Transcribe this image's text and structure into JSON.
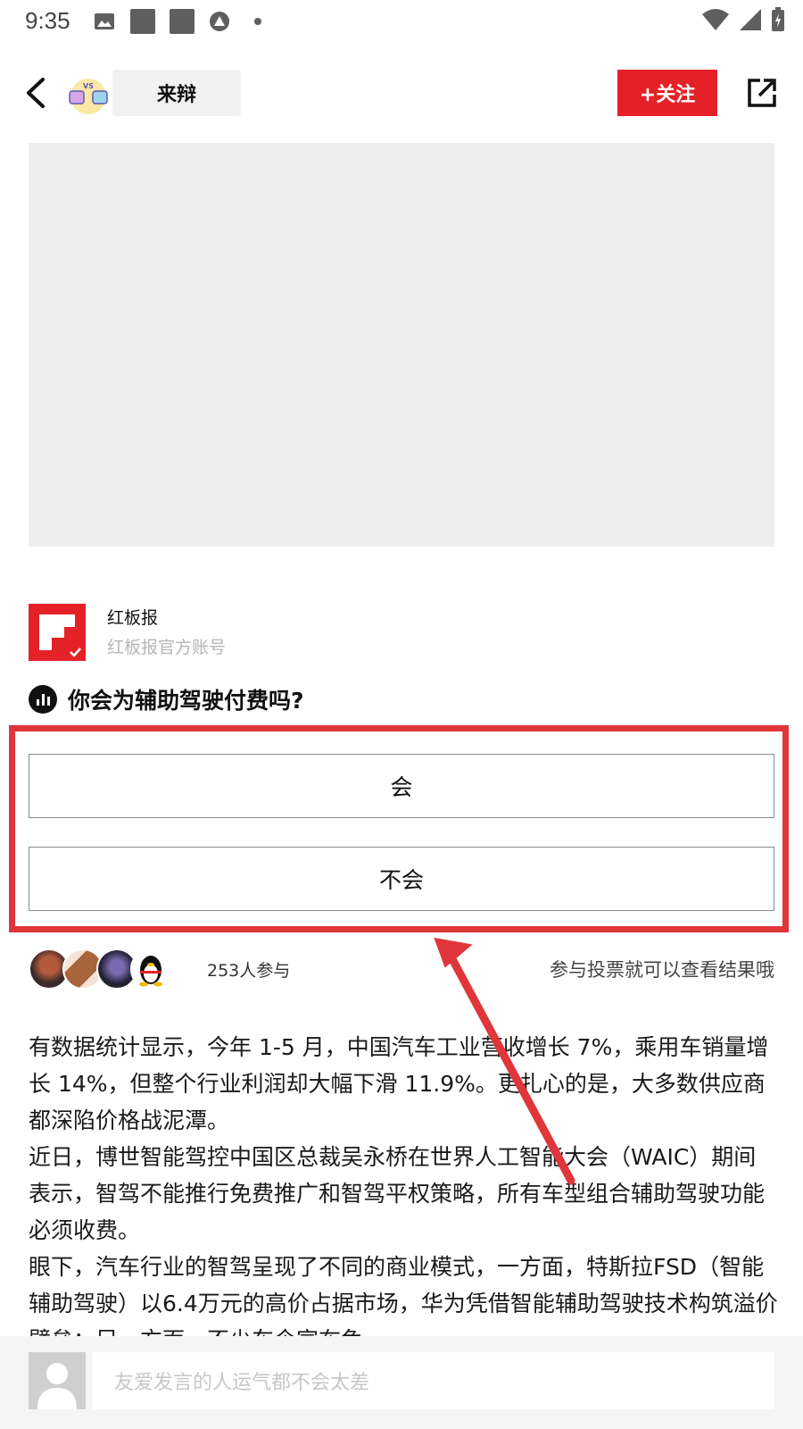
{
  "status_bar": {
    "time": "9:35"
  },
  "header": {
    "channel_name": "来辩",
    "logo_text": "VS",
    "follow_label": "+关注"
  },
  "author": {
    "name": "红板报",
    "description": "红板报官方账号"
  },
  "poll": {
    "question": "你会为辅助驾驶付费吗?",
    "options": [
      {
        "label": "会"
      },
      {
        "label": "不会"
      }
    ],
    "participants": "253人参与",
    "hint": "参与投票就可以查看结果哦"
  },
  "article": {
    "paragraphs": [
      "有数据统计显示，今年 1-5 月，中国汽车工业营收增长 7%，乘用车销量增长 14%，但整个行业利润却大幅下滑 11.9%。更扎心的是，大多数供应商都深陷价格战泥潭。",
      "近日，博世智能驾控中国区总裁吴永桥在世界人工智能大会（WAIC）期间表示，智驾不能推行免费推广和智驾平权策略，所有车型组合辅助驾驶功能必须收费。",
      "眼下，汽车行业的智驾呈现了不同的商业模式，一方面，特斯拉FSD（智能辅助驾驶）以6.4万元的高价占据市场，华为凭借智能辅助驾驶技术构筑溢价壁垒；另一方面，不少车企宣布免"
    ]
  },
  "comment": {
    "placeholder": "友爱发言的人运气都不会太差"
  },
  "colors": {
    "accent": "#e52128",
    "highlight": "#e0353a"
  }
}
